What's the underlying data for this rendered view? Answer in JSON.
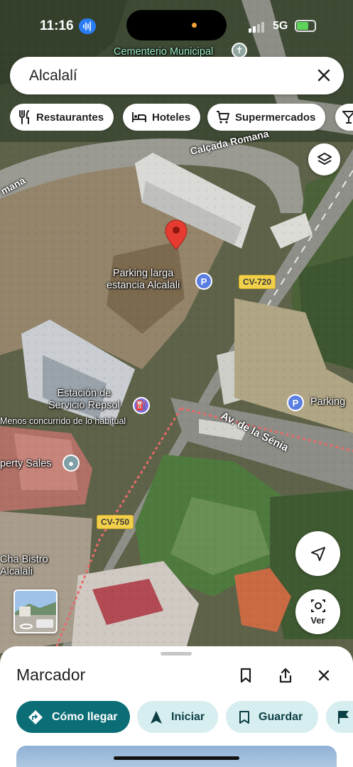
{
  "status_bar": {
    "time": "11:16",
    "network": "5G"
  },
  "search": {
    "query": "Alcalalí"
  },
  "chips": [
    {
      "label": "Restaurantes",
      "icon": "fork-knife-icon"
    },
    {
      "label": "Hoteles",
      "icon": "bed-icon"
    },
    {
      "label": "Supermercados",
      "icon": "cart-icon"
    }
  ],
  "map": {
    "labels": {
      "cemetery": "Cementerio Municipal",
      "calcada": "Calçada Romana",
      "romana_left": "mana",
      "parking_larga": "Parking larga\nestancia Alcalali",
      "repsol": "Estación de\nServicio Repsol",
      "repsol_sub": "Menos concurrido de lo habitual",
      "parking": "Parking",
      "property": "perty Sales",
      "bistro": "Cha Bistro\nAlcalali",
      "avenida": "Av. de la Sénia"
    },
    "roads": {
      "cv720": "CV-720",
      "cv750": "CV-750"
    }
  },
  "buttons": {
    "ver": "Ver"
  },
  "sheet": {
    "title": "Marcador",
    "actions": [
      {
        "label": "Cómo llegar",
        "icon": "directions-icon"
      },
      {
        "label": "Iniciar",
        "icon": "navigation-arrow-icon"
      },
      {
        "label": "Guardar",
        "icon": "bookmark-icon"
      }
    ]
  },
  "colors": {
    "primary": "#0b6e76",
    "secondary": "#d7eef0",
    "pin": "#e53b30"
  }
}
